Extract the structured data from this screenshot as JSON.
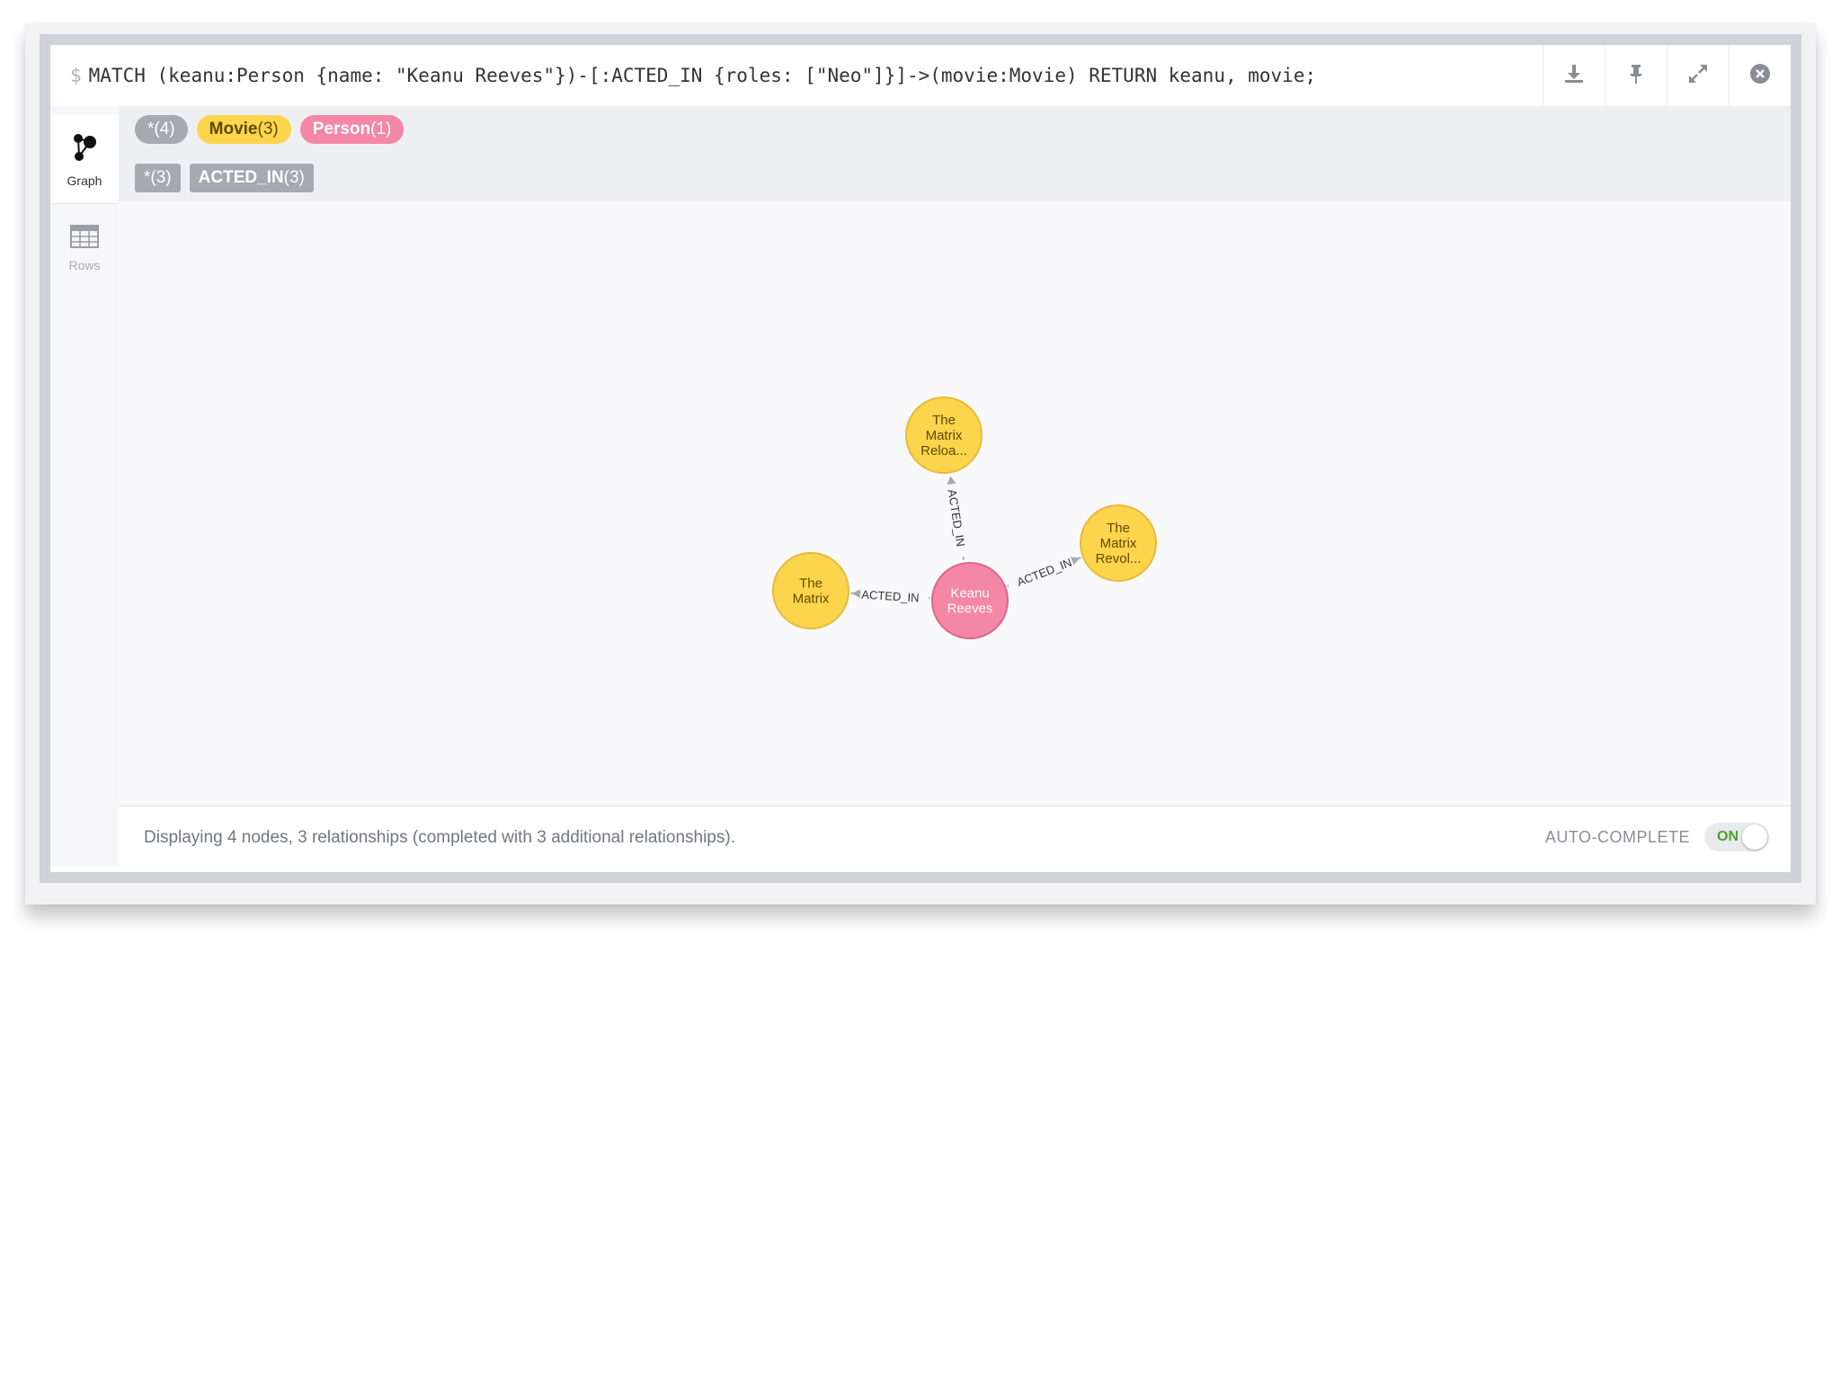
{
  "query": {
    "prompt": "$",
    "text": "MATCH (keanu:Person {name: \"Keanu Reeves\"})-[:ACTED_IN {roles: [\"Neo\"]}]->(movie:Movie) RETURN keanu, movie;"
  },
  "actions": [
    {
      "name": "download-icon"
    },
    {
      "name": "pin-icon"
    },
    {
      "name": "expand-icon"
    },
    {
      "name": "close-icon"
    }
  ],
  "sidebar": {
    "graph_label": "Graph",
    "rows_label": "Rows"
  },
  "legend": {
    "labels": [
      {
        "name": "*",
        "count": "(4)",
        "color": "#a5a9b0"
      },
      {
        "name": "Movie",
        "count": "(3)",
        "color": "#fcd54c"
      },
      {
        "name": "Person",
        "count": "(1)",
        "color": "#f486a6"
      }
    ],
    "relationships": [
      {
        "name": "*",
        "count": "(3)"
      },
      {
        "name": "ACTED_IN",
        "count": "(3)"
      }
    ]
  },
  "graph": {
    "nodes": [
      {
        "id": "keanu",
        "lines": [
          "Keanu",
          "Reeves"
        ],
        "label": "Person",
        "color": "#f486a6",
        "stroke": "#e0648b",
        "text_color": "#ffffff"
      },
      {
        "id": "matrix",
        "lines": [
          "The",
          "Matrix"
        ],
        "label": "Movie",
        "color": "#fcd54c",
        "stroke": "#e8b93a",
        "text_color": "#5f4a00"
      },
      {
        "id": "reloaded",
        "lines": [
          "The",
          "Matrix",
          "Reloa..."
        ],
        "label": "Movie",
        "color": "#fcd54c",
        "stroke": "#e8b93a",
        "text_color": "#5f4a00"
      },
      {
        "id": "revolutions",
        "lines": [
          "The",
          "Matrix",
          "Revol..."
        ],
        "label": "Movie",
        "color": "#fcd54c",
        "stroke": "#e8b93a",
        "text_color": "#5f4a00"
      }
    ],
    "relationships": [
      {
        "from": "keanu",
        "to": "matrix",
        "type": "ACTED_IN"
      },
      {
        "from": "keanu",
        "to": "reloaded",
        "type": "ACTED_IN"
      },
      {
        "from": "keanu",
        "to": "revolutions",
        "type": "ACTED_IN"
      }
    ]
  },
  "footer": {
    "status": "Displaying 4 nodes, 3 relationships (completed with 3 additional relationships).",
    "autocomplete_label": "AUTO-COMPLETE",
    "toggle_state": "ON"
  }
}
